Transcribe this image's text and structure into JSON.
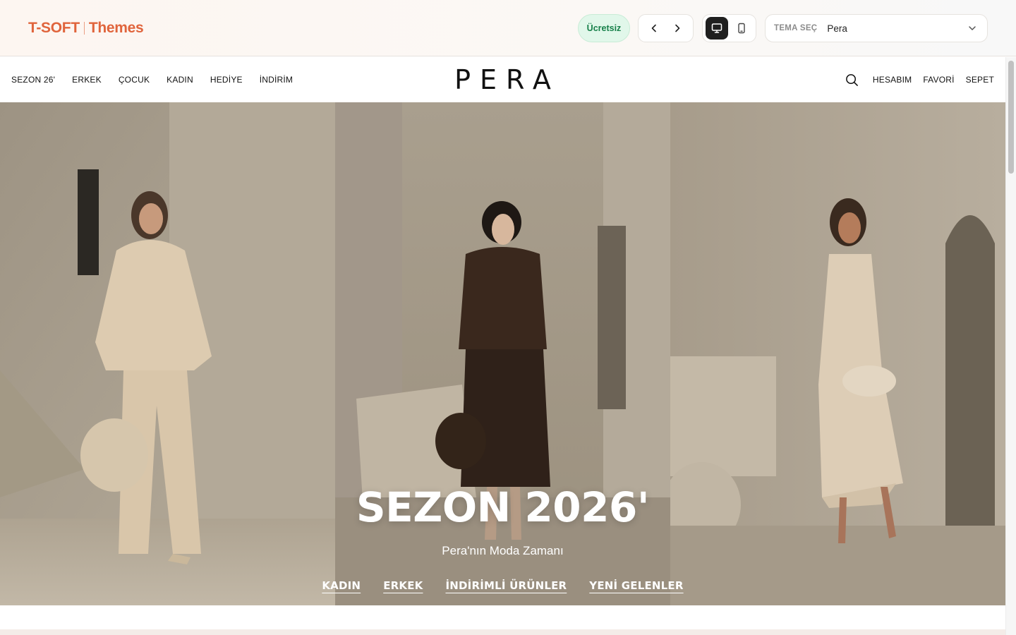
{
  "theme_bar": {
    "brand_primary": "T-SOFT",
    "brand_secondary": "Themes",
    "free_badge": "Ücretsiz",
    "prev_icon": "chevron-left-icon",
    "next_icon": "chevron-right-icon",
    "devices": [
      {
        "icon": "desktop-icon",
        "active": true
      },
      {
        "icon": "mobile-icon",
        "active": false
      }
    ],
    "theme_select": {
      "label": "TEMA SEÇ",
      "value": "Pera"
    }
  },
  "store": {
    "logo": "PERA",
    "menu_left": [
      "SEZON 26'",
      "ERKEK",
      "ÇOCUK",
      "KADIN",
      "HEDİYE",
      "İNDİRİM"
    ],
    "menu_right": [
      "HESABIM",
      "FAVORİ",
      "SEPET"
    ],
    "search_icon": "search-icon"
  },
  "hero": {
    "title": "SEZON 2026'",
    "subtitle": "Pera'nın Moda Zamanı",
    "links": [
      "KADIN",
      "ERKEK",
      "İNDİRİMLİ ÜRÜNLER",
      "YENİ GELENLER"
    ]
  },
  "colors": {
    "accent": "#e0643c",
    "badge_bg": "#e1f7ea",
    "badge_text": "#17804a",
    "active_device": "#1f1f1f"
  }
}
